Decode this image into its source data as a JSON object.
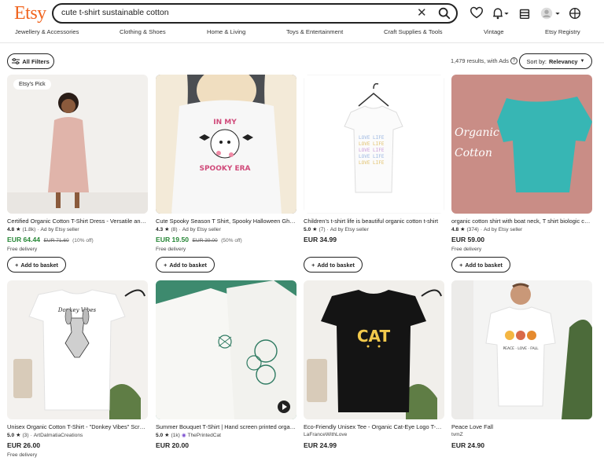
{
  "header": {
    "logo": "Etsy",
    "search_value": "cute t-shirt sustainable cotton",
    "clear_icon": "close-icon",
    "icons": [
      "search-icon",
      "heart-icon",
      "bell-icon",
      "gift-icon",
      "avatar",
      "cart-icon"
    ],
    "accent": "#f1641e"
  },
  "categories": [
    "Jewellery & Accessories",
    "Clothing & Shoes",
    "Home & Living",
    "Toys & Entertainment",
    "Craft Supplies & Tools",
    "Vintage",
    "Etsy Registry"
  ],
  "filters": {
    "all_filters": "All Filters",
    "results": "1,479 results, with Ads",
    "sort_prefix": "Sort by:",
    "sort_value": "Relevancy"
  },
  "basket_label": "Add to basket",
  "products": [
    {
      "badge": "Etsy's Pick",
      "title": "Certified Organic Cotton T-Shirt Dress - Versatile and Comfortable",
      "rating": "4.8",
      "reviews": "(1.8k)",
      "seller": "Ad by Etsy seller",
      "price": "EUR 64.44",
      "original": "EUR 71.60",
      "discount": "(10% off)",
      "delivery": "Free delivery",
      "sale": true
    },
    {
      "title": "Cute Spooky Season T Shirt, Spooky Halloween Ghost Tee",
      "rating": "4.3",
      "reviews": "(8)",
      "seller": "Ad by Etsy seller",
      "price": "EUR 19.50",
      "original": "EUR 39.00",
      "discount": "(50% off)",
      "delivery": "Free delivery",
      "sale": true
    },
    {
      "title": "Children's t-shirt life is beautiful organic cotton t-shirt",
      "rating": "5.0",
      "reviews": "(7)",
      "seller": "Ad by Etsy seller",
      "price": "EUR 34.99",
      "sale": false
    },
    {
      "title": "organic cotton shirt with boat neck, T shirt biologic cotton",
      "rating": "4.8",
      "reviews": "(374)",
      "seller": "Ad by Etsy seller",
      "price": "EUR 59.00",
      "delivery": "Free delivery",
      "sale": false
    },
    {
      "title": "Unisex Organic Cotton T-Shirt - \"Donkey Vibes\" Screen Printed",
      "rating": "5.0",
      "reviews": "(3)",
      "seller": "ArtDalmatiaCreations",
      "price": "EUR 26.00",
      "delivery": "Free delivery",
      "sale": false
    },
    {
      "title": "Summer Bouquet T-Shirt | Hand screen printed organic cotton tee",
      "rating": "5.0",
      "reviews": "(1k)",
      "seller": "ThePrintedCat",
      "price": "EUR 20.00",
      "sale": false,
      "video": true
    },
    {
      "title": "Eco-Friendly Unisex Tee - Organic Cat-Eye Logo T-Shirt",
      "seller": "LaFranceWithLove",
      "price": "EUR 24.99",
      "sale": false
    },
    {
      "title": "Peace Love Fall",
      "seller": "tvmZ",
      "price": "EUR 24.90",
      "sale": false
    }
  ],
  "image_art": {
    "shirt1_text": "IN MY SPOOKY ERA",
    "shirt4_text": "Organic Cotton",
    "shirt5_text": "Donkey Vibes",
    "shirt7_text": "CAT",
    "shirt8_text": "PEACE · LOVE · FALL"
  }
}
